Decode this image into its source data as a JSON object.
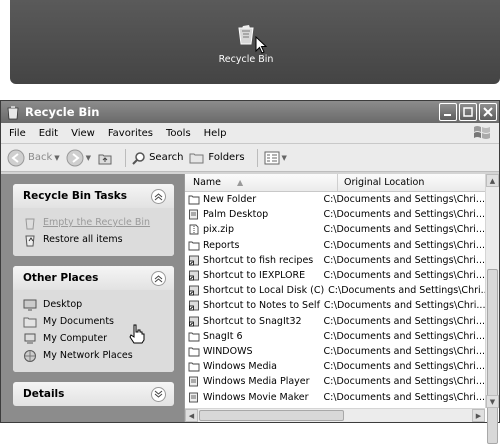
{
  "desktop": {
    "icon_label": "Recycle Bin"
  },
  "window": {
    "title": "Recycle Bin"
  },
  "menu": [
    "File",
    "Edit",
    "View",
    "Favorites",
    "Tools",
    "Help"
  ],
  "toolbar": {
    "back": "Back",
    "search": "Search",
    "folders": "Folders"
  },
  "left": {
    "tasks_title": "Recycle Bin Tasks",
    "tasks": [
      "Empty the Recycle Bin",
      "Restore all items"
    ],
    "places_title": "Other Places",
    "places": [
      "Desktop",
      "My Documents",
      "My Computer",
      "My Network Places"
    ],
    "details_title": "Details"
  },
  "columns": {
    "name": "Name",
    "location": "Original Location"
  },
  "files": [
    {
      "name": "New Folder",
      "location": "C:\\Documents and Settings\\Chri...",
      "icon": "folder"
    },
    {
      "name": "Palm Desktop",
      "location": "C:\\Documents and Settings\\Chri...",
      "icon": "app"
    },
    {
      "name": "pix.zip",
      "location": "C:\\Documents and Settings\\Chri...",
      "icon": "zip"
    },
    {
      "name": "Reports",
      "location": "C:\\Documents and Settings\\Chri...",
      "icon": "folder"
    },
    {
      "name": "Shortcut to fish recipes",
      "location": "C:\\Documents and Settings\\Chri...",
      "icon": "shortcut"
    },
    {
      "name": "Shortcut to IEXPLORE",
      "location": "C:\\Documents and Settings\\Chri...",
      "icon": "shortcut"
    },
    {
      "name": "Shortcut to Local Disk (C)",
      "location": "C:\\Documents and Settings\\Chri...",
      "icon": "shortcut"
    },
    {
      "name": "Shortcut to Notes to Self",
      "location": "C:\\Documents and Settings\\Chri...",
      "icon": "shortcut"
    },
    {
      "name": "Shortcut to SnagIt32",
      "location": "C:\\Documents and Settings\\Chri...",
      "icon": "shortcut"
    },
    {
      "name": "SnagIt 6",
      "location": "C:\\Documents and Settings\\Chri...",
      "icon": "folder"
    },
    {
      "name": "WINDOWS",
      "location": "C:\\Documents and Settings\\Chri...",
      "icon": "folder"
    },
    {
      "name": "Windows Media",
      "location": "C:\\Documents and Settings\\Chri...",
      "icon": "folder"
    },
    {
      "name": "Windows Media Player",
      "location": "C:\\Documents and Settings\\Chri...",
      "icon": "app"
    },
    {
      "name": "Windows Movie Maker",
      "location": "C:\\Documents and Settings\\Chri...",
      "icon": "app"
    }
  ]
}
